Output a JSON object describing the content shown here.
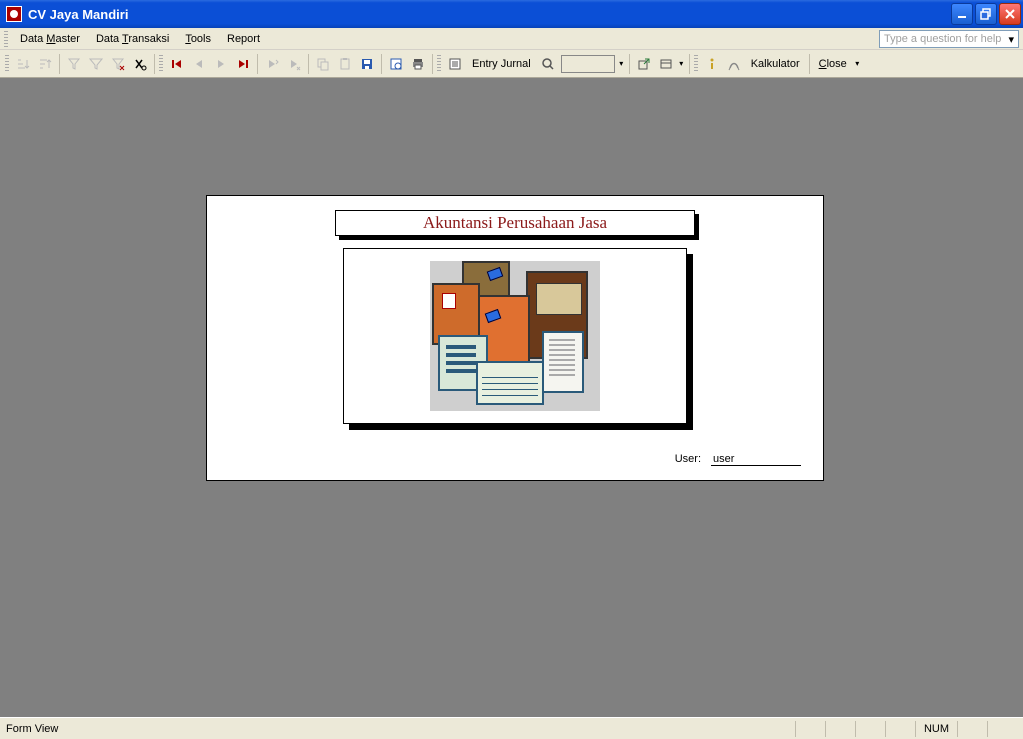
{
  "app": {
    "title": "CV Jaya Mandiri"
  },
  "menu": {
    "data_master": "Data Master",
    "data_transaksi": "Data Transaksi",
    "tools": "Tools",
    "report": "Report",
    "help_placeholder": "Type a question for help"
  },
  "toolbar": {
    "entry_jurnal": "Entry Jurnal",
    "kalkulator": "Kalkulator",
    "close": "Close"
  },
  "form": {
    "title": "Akuntansi Perusahaan Jasa",
    "user_label": "User:",
    "user_value": "user"
  },
  "status": {
    "mode": "Form View",
    "num": "NUM"
  }
}
